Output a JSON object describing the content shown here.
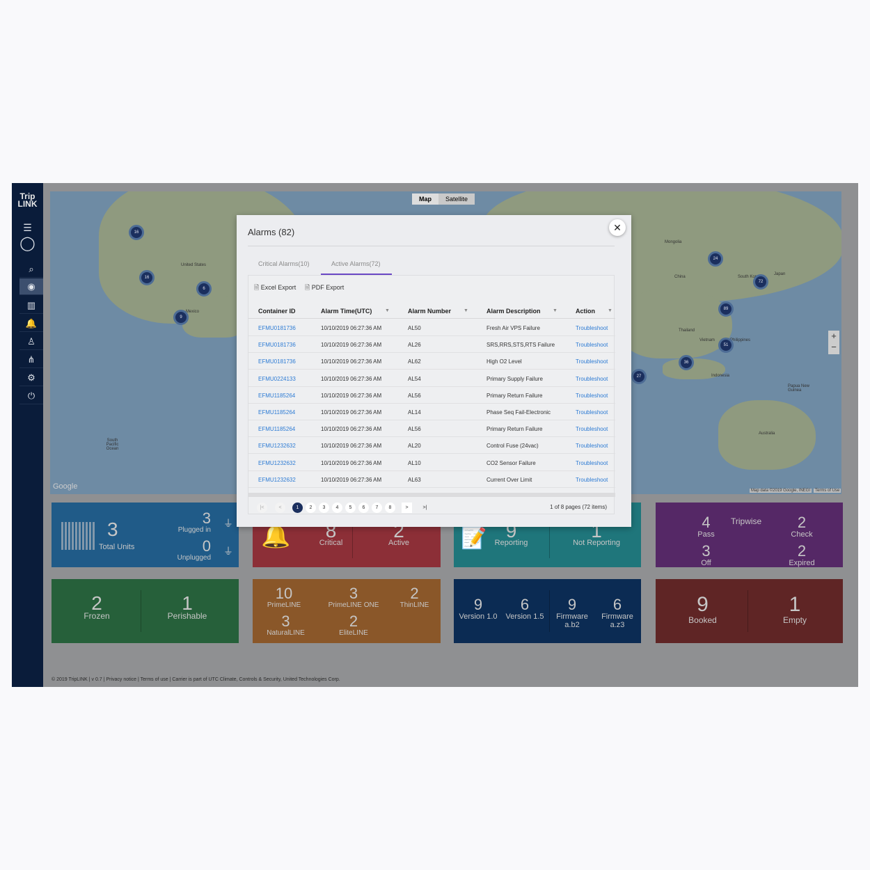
{
  "app": {
    "logo": "Trip LINK",
    "logo_line1": "Trip",
    "logo_line2": "LINK"
  },
  "sidebar": {
    "items": [
      {
        "icon": "menu-icon",
        "glyph": "☰"
      },
      {
        "icon": "user-icon",
        "glyph": "◯"
      },
      {
        "icon": "search-icon",
        "glyph": "⌕"
      },
      {
        "icon": "dashboard-icon",
        "glyph": "◉",
        "active": true
      },
      {
        "icon": "container-icon",
        "glyph": "▥"
      },
      {
        "icon": "bell-icon",
        "glyph": "🔔"
      },
      {
        "icon": "person-icon",
        "glyph": "♙"
      },
      {
        "icon": "hierarchy-icon",
        "glyph": "⋔"
      },
      {
        "icon": "gear-icon",
        "glyph": "⚙"
      },
      {
        "icon": "power-icon",
        "glyph": "⏻"
      }
    ]
  },
  "map": {
    "type_buttons": [
      "Map",
      "Satellite"
    ],
    "attribution": "Map data ©2019 Google, INEGI",
    "terms": "Terms of Use",
    "google": "Google",
    "labels": [
      "United States",
      "Mexico",
      "China",
      "Mongolia",
      "Indonesia",
      "Australia",
      "Japan",
      "South Korea",
      "Philippines",
      "Vietnam",
      "Thailand",
      "Papua New Guinea",
      "South Pacific Ocean"
    ],
    "clusters": [
      "16",
      "16",
      "6",
      "9",
      "24",
      "72",
      "89",
      "51",
      "36",
      "27"
    ]
  },
  "modal": {
    "title": "Alarms (82)",
    "close": "✕",
    "tabs": [
      "Critical Alarms(10)",
      "Active Alarms(72)"
    ],
    "excel": "Excel Export",
    "pdf": "PDF Export",
    "columns": [
      "Container ID",
      "Alarm Time(UTC)",
      "Alarm Number",
      "Alarm Description",
      "Action"
    ],
    "rows": [
      [
        "EFMU0181736",
        "10/10/2019 06:27:36 AM",
        "AL50",
        "Fresh Air VPS Failure",
        "Troubleshoot"
      ],
      [
        "EFMU0181736",
        "10/10/2019 06:27:36 AM",
        "AL26",
        "SRS,RRS,STS,RTS Failure",
        "Troubleshoot"
      ],
      [
        "EFMU0181736",
        "10/10/2019 06:27:36 AM",
        "AL62",
        "High O2 Level",
        "Troubleshoot"
      ],
      [
        "EFMU0224133",
        "10/10/2019 06:27:36 AM",
        "AL54",
        "Primary Supply Failure",
        "Troubleshoot"
      ],
      [
        "EFMU1185264",
        "10/10/2019 06:27:36 AM",
        "AL56",
        "Primary Return Failure",
        "Troubleshoot"
      ],
      [
        "EFMU1185264",
        "10/10/2019 06:27:36 AM",
        "AL14",
        "Phase Seq Fail-Electronic",
        "Troubleshoot"
      ],
      [
        "EFMU1185264",
        "10/10/2019 06:27:36 AM",
        "AL56",
        "Primary Return Failure",
        "Troubleshoot"
      ],
      [
        "EFMU1232632",
        "10/10/2019 06:27:36 AM",
        "AL20",
        "Control Fuse (24vac)",
        "Troubleshoot"
      ],
      [
        "EFMU1232632",
        "10/10/2019 06:27:36 AM",
        "AL10",
        "CO2 Sensor Failure",
        "Troubleshoot"
      ],
      [
        "EFMU1232632",
        "10/10/2019 06:27:36 AM",
        "AL63",
        "Current Over Limit",
        "Troubleshoot"
      ]
    ],
    "pager": {
      "pages": [
        "1",
        "2",
        "3",
        "4",
        "5",
        "6",
        "7",
        "8"
      ],
      "current": "1",
      "first": "|<",
      "prev": "<",
      "next": ">",
      "last": ">|",
      "info": "1 of 8 pages (72 items)"
    }
  },
  "tiles": {
    "units": {
      "total": "3",
      "total_label": "Total Units",
      "plugged": "3",
      "plugged_label": "Plugged in",
      "unplugged": "0",
      "unplugged_label": "Unplugged",
      "color": "#205b88"
    },
    "alarms": {
      "critical": "8",
      "critical_label": "Critical",
      "active": "2",
      "active_label": "Active",
      "color": "#8c2f37"
    },
    "reporting": {
      "reporting": "9",
      "reporting_label": "Reporting",
      "not": "1",
      "not_label": "Not Reporting",
      "color": "#1f767b"
    },
    "tripwise": {
      "title": "Tripwise",
      "pass": "4",
      "pass_label": "Pass",
      "check": "2",
      "check_label": "Check",
      "off": "3",
      "off_label": "Off",
      "expired": "2",
      "expired_label": "Expired",
      "color": "#552866"
    },
    "cargo": {
      "frozen": "2",
      "frozen_label": "Frozen",
      "perishable": "1",
      "perishable_label": "Perishable",
      "color": "#26603a"
    },
    "models": {
      "items": [
        [
          "10",
          "PrimeLINE"
        ],
        [
          "3",
          "PrimeLINE ONE"
        ],
        [
          "2",
          "ThinLINE"
        ],
        [
          "3",
          "NaturalLINE"
        ],
        [
          "2",
          "EliteLINE"
        ]
      ],
      "color": "#8a5729"
    },
    "versions": {
      "items": [
        [
          "9",
          "Version 1.0"
        ],
        [
          "6",
          "Version 1.5"
        ],
        [
          "9",
          "Firmware a.b2"
        ],
        [
          "6",
          "Firmware a.z3"
        ]
      ],
      "color": "#0b2b53"
    },
    "booking": {
      "booked": "9",
      "booked_label": "Booked",
      "empty": "1",
      "empty_label": "Empty",
      "color": "#5f2525"
    }
  },
  "footer": "© 2019 TripLINK | v 0.7 | Privacy notice | Terms of use | Carrier is part of UTC Climate, Controls & Security, United Technologies Corp."
}
